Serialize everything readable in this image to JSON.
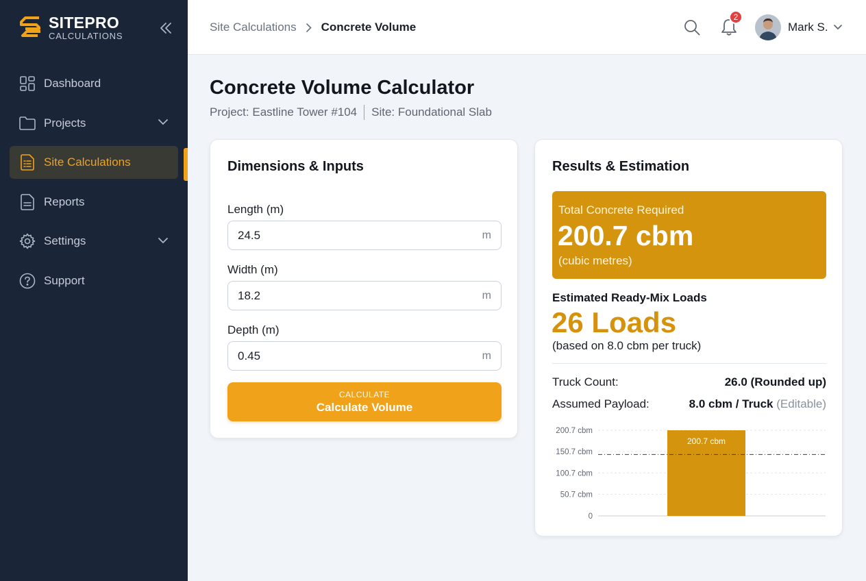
{
  "brand": {
    "name": "SITEPRO",
    "subtitle": "CALCULATIONS"
  },
  "sidebar": {
    "items": [
      {
        "label": "Dashboard",
        "icon": "grid-icon"
      },
      {
        "label": "Projects",
        "icon": "folder-icon",
        "has_submenu": true
      },
      {
        "label": "Site Calculations",
        "icon": "document-list-icon",
        "active": true
      },
      {
        "label": "Reports",
        "icon": "file-icon"
      },
      {
        "label": "Settings",
        "icon": "gear-icon",
        "has_submenu": true
      },
      {
        "label": "Support",
        "icon": "help-circle-icon"
      }
    ]
  },
  "header": {
    "breadcrumb": [
      "Site Calculations",
      "Concrete Volume"
    ],
    "notification_count": "2",
    "user_name": "Mark S."
  },
  "page": {
    "title": "Concrete Volume Calculator",
    "project": "Project: Eastline Tower #104",
    "site": "Site: Foundational Slab"
  },
  "inputs": {
    "title": "Dimensions & Inputs",
    "fields": [
      {
        "label": "Length (m)",
        "value": "24.5",
        "unit": "m"
      },
      {
        "label": "Width (m)",
        "value": "18.2",
        "unit": "m"
      },
      {
        "label": "Depth (m)",
        "value": "0.45",
        "unit": "m"
      }
    ],
    "button_small": "CALCULATE",
    "button_main": "Calculate Volume"
  },
  "results": {
    "title": "Results & Estimation",
    "total_label": "Total Concrete Required",
    "total_value": "200.7 cbm",
    "total_unit": "(cubic metres)",
    "loads_label": "Estimated Ready-Mix Loads",
    "loads_value": "26 Loads",
    "loads_note": "(based on 8.0 cbm per truck)",
    "truck_count_label": "Truck Count:",
    "truck_count_value": "26.0 (Rounded up)",
    "payload_label": "Assumed Payload:",
    "payload_value": "8.0 cbm / Truck",
    "payload_edit": "(Editable)"
  },
  "colors": {
    "accent": "#f0a21b",
    "result_box": "#d4940d",
    "sidebar_bg": "#1b2538",
    "badge": "#e53e3e"
  },
  "chart_data": {
    "type": "bar",
    "categories": [
      ""
    ],
    "values": [
      200.7
    ],
    "data_labels": [
      "200.7 cbm"
    ],
    "reference_line": 144,
    "ylim": [
      0,
      200.7
    ],
    "yticks": [
      0,
      50.7,
      100.7,
      150.7,
      200.7
    ],
    "ytick_labels": [
      "0",
      "50.7 cbm",
      "100.7 cbm",
      "150.7 cbm",
      "200.7 cbm"
    ],
    "grid": true,
    "bar_color": "#d4940d"
  }
}
